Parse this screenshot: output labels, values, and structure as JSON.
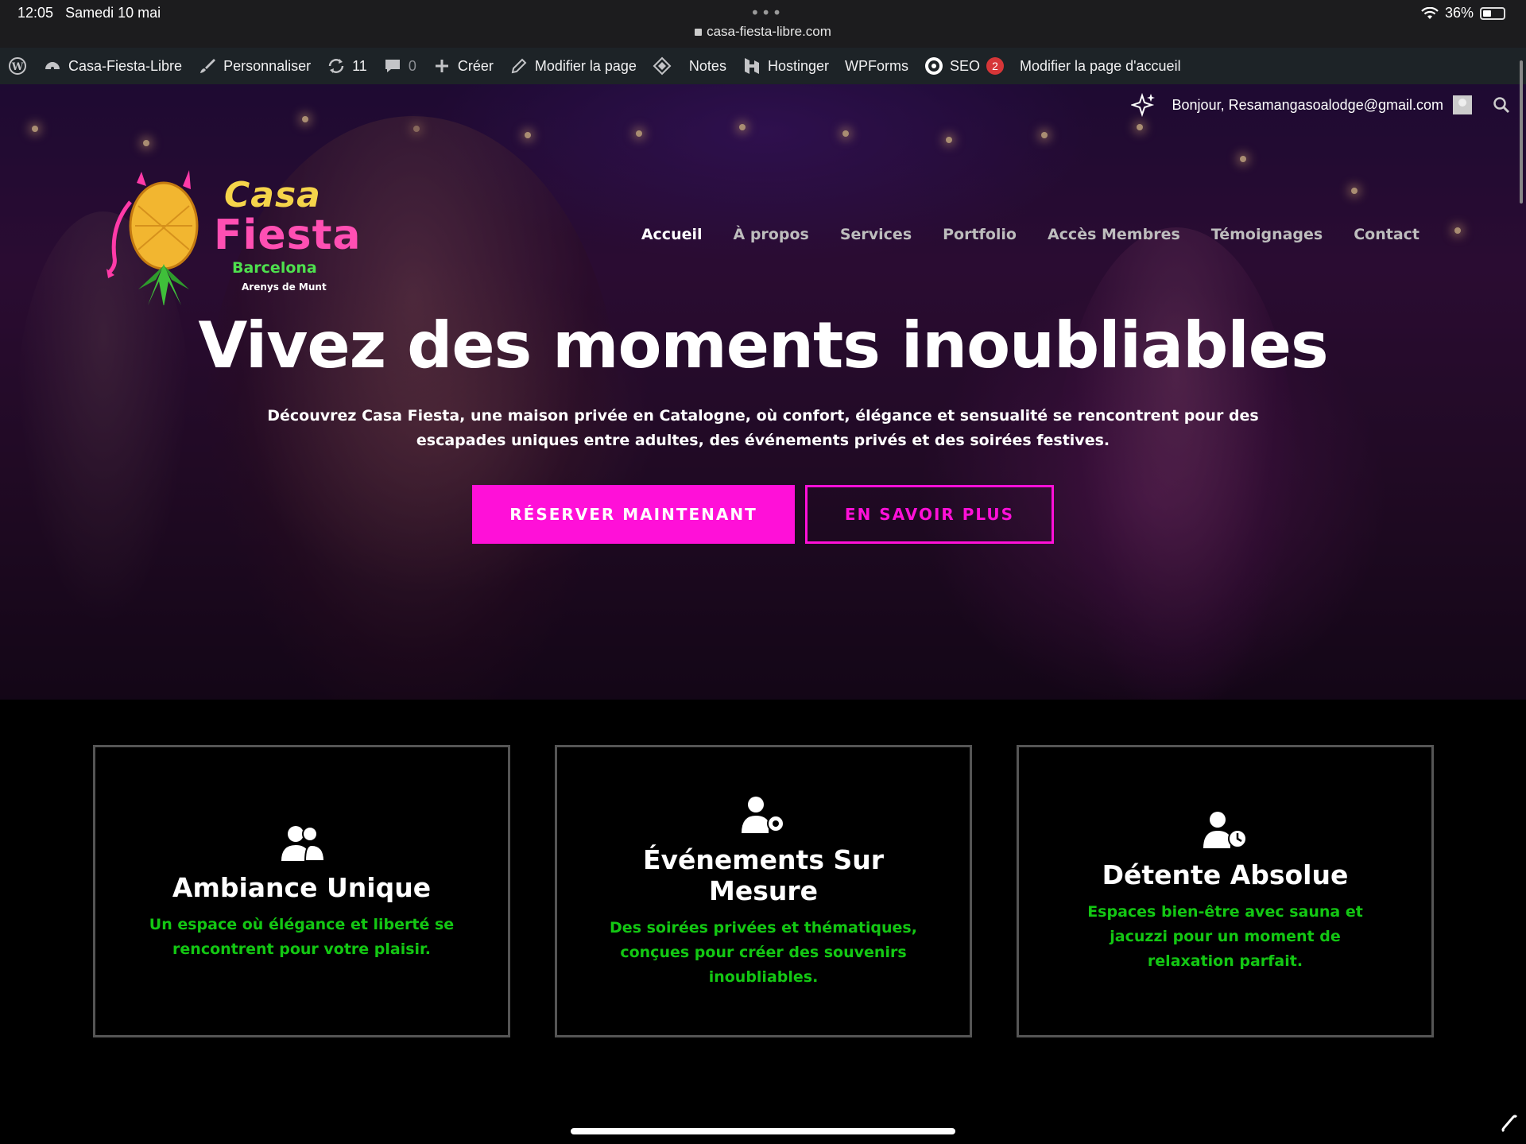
{
  "status_bar": {
    "time": "12:05",
    "date": "Samedi 10 mai",
    "url": "casa-fiesta-libre.com",
    "battery": "36%",
    "battery_level": 0.36
  },
  "admin_bar": {
    "site_name": "Casa-Fiesta-Libre",
    "customize": "Personnaliser",
    "updates_count": "11",
    "comments_count": "0",
    "create": "Créer",
    "edit_page": "Modifier la page",
    "notes": "Notes",
    "hostinger": "Hostinger",
    "wpforms": "WPForms",
    "seo": "SEO",
    "seo_badge": "2",
    "edit_home": "Modifier la page d'accueil"
  },
  "header": {
    "greeting": "Bonjour, Resamangasoalodge@gmail.com",
    "logo": {
      "line1": "Casa",
      "line2": "Fiesta",
      "line3": "Barcelona",
      "line4": "Arenys de Munt"
    },
    "nav": [
      {
        "label": "Accueil",
        "active": true
      },
      {
        "label": "À propos"
      },
      {
        "label": "Services"
      },
      {
        "label": "Portfolio"
      },
      {
        "label": "Accès Membres"
      },
      {
        "label": "Témoignages"
      },
      {
        "label": "Contact"
      }
    ]
  },
  "hero": {
    "title": "Vivez des moments inoubliables",
    "subtitle": "Découvrez Casa Fiesta, une maison privée en Catalogne, où confort, élégance et sensualité se rencontrent pour des escapades uniques entre adultes, des événements privés et des soirées festives.",
    "primary_button": "RÉSERVER MAINTENANT",
    "secondary_button": "EN SAVOIR PLUS"
  },
  "features": [
    {
      "icon": "users-icon",
      "title": "Ambiance Unique",
      "text": "Un espace où élégance et liberté se rencontrent pour votre plaisir."
    },
    {
      "icon": "user-gear-icon",
      "title": "Événements Sur Mesure",
      "text": "Des soirées privées et thématiques, conçues pour créer des souvenirs inoubliables."
    },
    {
      "icon": "user-clock-icon",
      "title": "Détente Absolue",
      "text": "Espaces bien-être avec sauna et jacuzzi pour un moment de relaxation parfait."
    }
  ],
  "colors": {
    "accent": "#ff10d8",
    "feature_text": "#13c713",
    "admin_bar": "#1d2327"
  }
}
